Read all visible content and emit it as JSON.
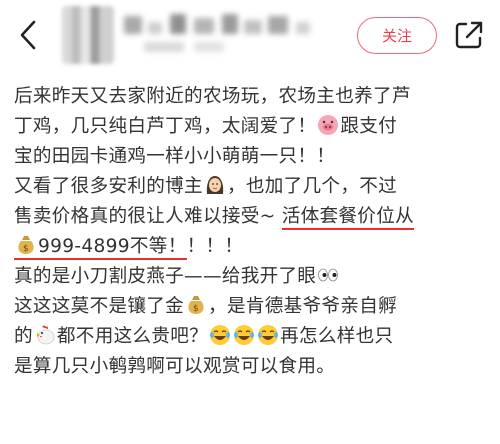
{
  "header": {
    "back_icon": "chevron-left-icon",
    "avatar_icon": "blurred-avatar",
    "username_icon": "blurred-username",
    "follow_label": "关注",
    "share_icon": "share-external-icon",
    "accent_color": "#ee3d4e"
  },
  "post": {
    "lines": [
      {
        "text": "后来昨天又去家附近的农场玩，农场主也养了芦"
      },
      {
        "text": "丁鸡，几只纯白芦丁鸡，太阔爱了！",
        "emoji": "pig-face-emoji",
        "after": "跟支付"
      },
      {
        "text": "宝的田园卡通鸡一样小小萌萌一只！！"
      },
      {
        "text": "又看了很多安利的博主",
        "emoji": "woman-emoji",
        "after": "，也加了几个，不过"
      },
      {
        "text": "售卖价格真的很让人难以接受~",
        "underlined": "活体套餐价位从"
      },
      {
        "emoji": "money-bag-emoji",
        "underlined": "999-4899不等！",
        "after": "！！！"
      },
      {
        "text": "真的是小刀割皮燕子——给我开了眼",
        "emoji": "eyes-emoji"
      },
      {
        "text": "这这这莫不是镶了金",
        "emoji": "money-bag-emoji",
        "after": "，是肯德基爷爷亲自孵"
      },
      {
        "text": "的",
        "emoji": "rooster-emoji",
        "after": "都不用这么贵吧？",
        "emoji_row": "three-laughing-emojis",
        "tail": "再怎么样也只"
      },
      {
        "text": "是算几只小鹌鹑啊可以观赏可以食用。"
      }
    ]
  }
}
